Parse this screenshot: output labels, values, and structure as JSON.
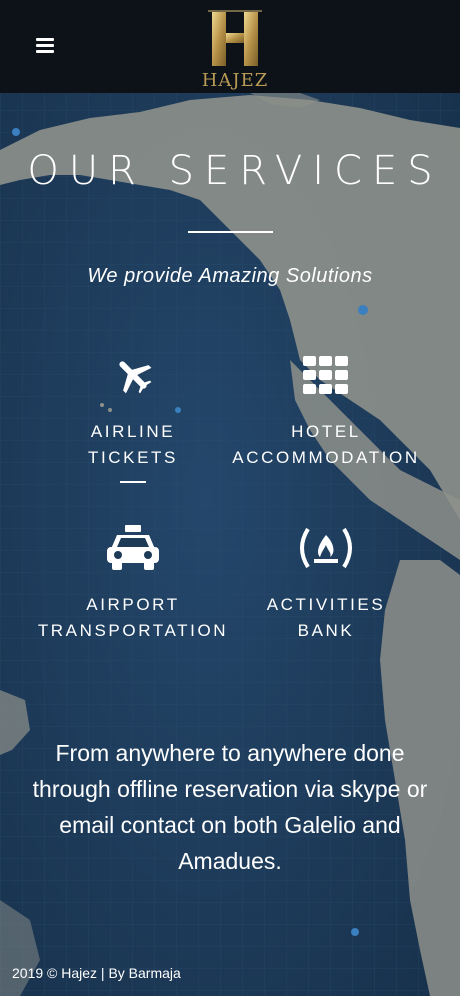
{
  "header": {
    "logo_text": "HAJEZ",
    "logo_letter": "H"
  },
  "main": {
    "title": "OUR SERVICES",
    "subtitle": "We provide Amazing Solutions",
    "services": [
      {
        "line1": "AIRLINE",
        "line2": "TICKETS",
        "icon": "airplane-icon"
      },
      {
        "line1": "HOTEL",
        "line2": "ACCOMMODATION",
        "icon": "building-grid-icon"
      },
      {
        "line1": "AIRPORT",
        "line2": "TRANSPORTATION",
        "icon": "taxi-icon"
      },
      {
        "line1": "ACTIVITIES",
        "line2": "BANK",
        "icon": "campfire-icon"
      }
    ],
    "description": "From anywhere to anywhere done through offline reservation via skype or email contact on both Galelio and Amadues."
  },
  "footer": {
    "text": "2019 © Hajez | By Barmaja"
  },
  "colors": {
    "header_bg": "#0c1218",
    "ocean": "#1d3a57",
    "land": "#8e918b",
    "logo_gold": "#b89a55"
  }
}
